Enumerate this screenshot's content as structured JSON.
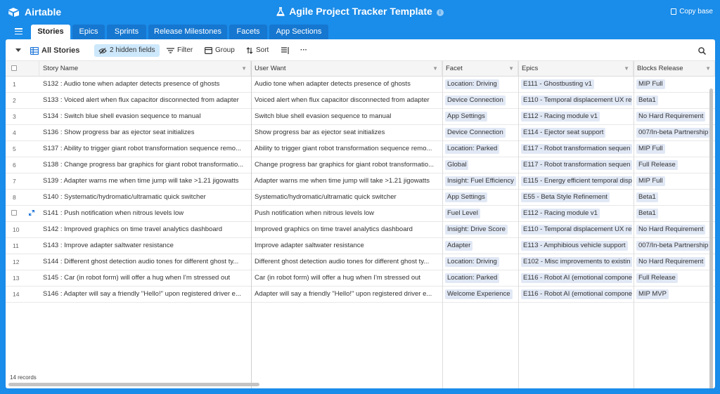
{
  "app": {
    "name": "Airtable",
    "base_title": "Agile Project Tracker Template",
    "copy_label": "Copy base"
  },
  "tabs": [
    "Stories",
    "Epics",
    "Sprints",
    "Release Milestones",
    "Facets",
    "App Sections"
  ],
  "active_tab": "Stories",
  "viewbar": {
    "view_name": "All Stories",
    "hidden_fields": "2 hidden fields",
    "filter": "Filter",
    "group": "Group",
    "sort": "Sort",
    "more": "···"
  },
  "columns": [
    "Story Name",
    "User Want",
    "Facet",
    "Epics",
    "Blocks Release"
  ],
  "rows": [
    {
      "num": "1",
      "name": "S132 : Audio tone when adapter detects presence of ghosts",
      "want": "Audio tone when adapter detects presence of ghosts",
      "facet": "Location: Driving",
      "epic": "E111 - Ghostbusting v1",
      "release": "MIP Full"
    },
    {
      "num": "2",
      "name": "S133 : Voiced alert when flux capacitor disconnected from adapter",
      "want": "Voiced alert when flux capacitor disconnected from adapter",
      "facet": "Device Connection",
      "epic": "E110 - Temporal displacement UX re",
      "release": "Beta1"
    },
    {
      "num": "3",
      "name": "S134 : Switch blue shell evasion sequence to manual",
      "want": "Switch blue shell evasion sequence to manual",
      "facet": "App Settings",
      "epic": "E112 - Racing module v1",
      "release": "No Hard Requirement"
    },
    {
      "num": "4",
      "name": "S136 : Show progress bar as ejector seat initializes",
      "want": "Show progress bar as ejector seat initializes",
      "facet": "Device Connection",
      "epic": "E114 - Ejector seat support",
      "release": "007/In-beta Partnership"
    },
    {
      "num": "5",
      "name": "S137 : Ability to trigger giant robot transformation sequence remo...",
      "want": "Ability to trigger giant robot transformation sequence remo...",
      "facet": "Location: Parked",
      "epic": "E117 - Robot transformation sequen",
      "release": "MIP Full"
    },
    {
      "num": "6",
      "name": "S138 : Change progress bar graphics for giant robot transformatio...",
      "want": "Change progress bar graphics for giant robot transformatio...",
      "facet": "Global",
      "epic": "E117 - Robot transformation sequen",
      "release": "Full Release"
    },
    {
      "num": "7",
      "name": "S139 : Adapter warns me when time jump will take >1.21 jigowatts",
      "want": "Adapter warns me when time jump will take >1.21 jigowatts",
      "facet": "Insight: Fuel Efficiency",
      "epic": "E115 - Energy efficient temporal disp",
      "release": "MIP Full"
    },
    {
      "num": "8",
      "name": "S140 : Systematic/hydromatic/ultramatic quick switcher",
      "want": "Systematic/hydromatic/ultramatic quick switcher",
      "facet": "App Settings",
      "epic": "E55 - Beta Style Refinement",
      "release": "Beta1"
    },
    {
      "num": "",
      "name": "S141 : Push notification when nitrous levels low",
      "want": "Push notification when nitrous levels low",
      "facet": "Fuel Level",
      "epic": "E112 - Racing module v1",
      "release": "Beta1"
    },
    {
      "num": "10",
      "name": "S142 : Improved graphics on time travel analytics dashboard",
      "want": "Improved graphics on time travel analytics dashboard",
      "facet": "Insight: Drive Score",
      "epic": "E110 - Temporal displacement UX re",
      "release": "No Hard Requirement"
    },
    {
      "num": "11",
      "name": "S143 : Improve adapter saltwater resistance",
      "want": "Improve adapter saltwater resistance",
      "facet": "Adapter",
      "epic": "E113 - Amphibious vehicle support",
      "release": "007/In-beta Partnership"
    },
    {
      "num": "12",
      "name": "S144 : Different ghost detection audio tones for different ghost ty...",
      "want": "Different ghost detection audio tones for different ghost ty...",
      "facet": "Location: Driving",
      "epic": "E102 - Misc improvements to existin",
      "release": "No Hard Requirement"
    },
    {
      "num": "13",
      "name": "S145 : Car (in robot form) will offer a hug when I'm stressed out",
      "want": "Car (in robot form) will offer a hug when I'm stressed out",
      "facet": "Location: Parked",
      "epic": "E116 - Robot AI (emotional compone",
      "release": "Full Release"
    },
    {
      "num": "14",
      "name": "S146 : Adapter will say a friendly \"Hello!\" upon registered driver e...",
      "want": "Adapter will say a friendly \"Hello!\" upon registered driver e...",
      "facet": "Welcome Experience",
      "epic": "E116 - Robot AI (emotional compone",
      "release": "MIP MVP"
    }
  ],
  "record_count": "14 records"
}
